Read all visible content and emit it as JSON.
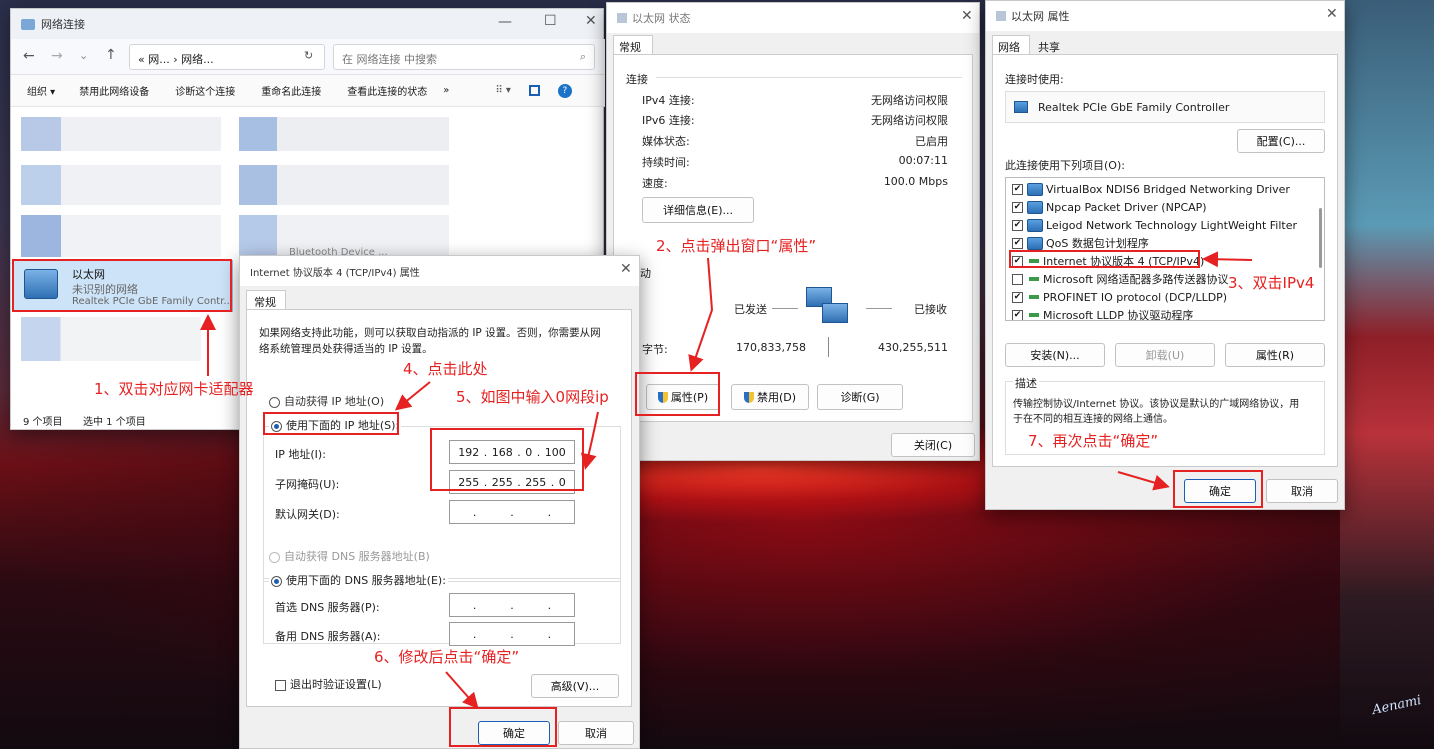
{
  "explorer": {
    "title": "网络连接",
    "address": "« 网... › 网络...",
    "search_placeholder": "在 网络连接 中搜索",
    "toolbar": [
      "组织 ▾",
      "禁用此网络设备",
      "诊断这个连接",
      "重命名此连接",
      "查看此连接的状态",
      "»"
    ],
    "adapter": {
      "name": "以太网",
      "status": "未识别的网络",
      "device": "Realtek PCIe GbE Family Contr..."
    },
    "bt_label": "Bluetooth Device ...",
    "status_count": "9 个项目",
    "status_selected": "选中 1 个项目"
  },
  "status_dialog": {
    "title": "以太网 状态",
    "tab": "常规",
    "section_connection": "连接",
    "rows": [
      {
        "label": "IPv4 连接:",
        "value": "无网络访问权限"
      },
      {
        "label": "IPv6 连接:",
        "value": "无网络访问权限"
      },
      {
        "label": "媒体状态:",
        "value": "已启用"
      },
      {
        "label": "持续时间:",
        "value": "00:07:11"
      },
      {
        "label": "速度:",
        "value": "100.0 Mbps"
      }
    ],
    "details_button": "详细信息(E)...",
    "section_activity": "动",
    "sent_label": "已发送",
    "received_label": "已接收",
    "bytes_label": "字节:",
    "bytes_sent": "170,833,758",
    "bytes_received": "430,255,511",
    "properties_button": "属性(P)",
    "disable_button": "禁用(D)",
    "diagnose_button": "诊断(G)",
    "close_button": "关闭(C)"
  },
  "props_dialog": {
    "title": "以太网 属性",
    "tabs": [
      "网络",
      "共享"
    ],
    "connect_using": "连接时使用:",
    "adapter": "Realtek PCIe GbE Family Controller",
    "configure_button": "配置(C)...",
    "items_label": "此连接使用下列项目(O):",
    "items": [
      {
        "checked": true,
        "label": "VirtualBox NDIS6 Bridged Networking Driver"
      },
      {
        "checked": true,
        "label": "Npcap Packet Driver (NPCAP)"
      },
      {
        "checked": true,
        "label": "Leigod Network Technology LightWeight Filter"
      },
      {
        "checked": true,
        "label": "QoS 数据包计划程序"
      },
      {
        "checked": true,
        "label": "Internet 协议版本 4 (TCP/IPv4)"
      },
      {
        "checked": false,
        "label": "Microsoft 网络适配器多路传送器协议"
      },
      {
        "checked": true,
        "label": "PROFINET IO protocol (DCP/LLDP)"
      },
      {
        "checked": true,
        "label": "Microsoft LLDP 协议驱动程序"
      }
    ],
    "install_button": "安装(N)...",
    "uninstall_button": "卸载(U)",
    "properties_button": "属性(R)",
    "desc_title": "描述",
    "desc_text1": "传输控制协议/Internet 协议。该协议是默认的广域网络协议，用",
    "desc_text2": "于在不同的相互连接的网络上通信。",
    "ok_button": "确定",
    "cancel_button": "取消"
  },
  "ipv4_dialog": {
    "title": "Internet 协议版本 4 (TCP/IPv4) 属性",
    "tab": "常规",
    "intro1": "如果网络支持此功能，则可以获取自动指派的 IP 设置。否则，你需要从网",
    "intro2": "络系统管理员处获得适当的 IP 设置。",
    "auto_ip": "自动获得 IP 地址(O)",
    "manual_ip": "使用下面的 IP 地址(S):",
    "ip_label": "IP 地址(I):",
    "ip": [
      "192",
      "168",
      "0",
      "100"
    ],
    "mask_label": "子网掩码(U):",
    "mask": [
      "255",
      "255",
      "255",
      "0"
    ],
    "gateway_label": "默认网关(D):",
    "auto_dns": "自动获得 DNS 服务器地址(B)",
    "manual_dns": "使用下面的 DNS 服务器地址(E):",
    "pref_dns": "首选 DNS 服务器(P):",
    "alt_dns": "备用 DNS 服务器(A):",
    "validate": "退出时验证设置(L)",
    "advanced_button": "高级(V)...",
    "ok_button": "确定",
    "cancel_button": "取消"
  },
  "annotations": {
    "a1": "1、双击对应网卡适配器",
    "a2": "2、点击弹出窗口“属性”",
    "a3": "3、双击IPv4",
    "a4": "4、点击此处",
    "a5": "5、如图中输入0网段ip",
    "a6": "6、修改后点击“确定”",
    "a7": "7、再次点击“确定”"
  },
  "signature": "Aenami",
  "colors": {
    "annotation": "#e62121",
    "accent": "#1a5fb4"
  }
}
